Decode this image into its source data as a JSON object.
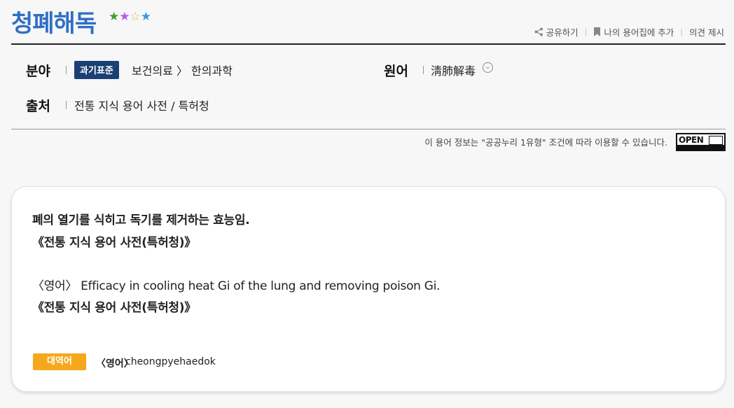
{
  "header": {
    "title": "청폐해독",
    "stars": [
      "★",
      "★",
      "☆",
      "★"
    ],
    "actions": {
      "share": "공유하기",
      "add_to_book": "나의 용어집에 추가",
      "feedback": "의견 제시"
    }
  },
  "fields": {
    "field_label": "분야",
    "field_badge": "과기표준",
    "field_value": "보건의료 〉 한의과학",
    "origin_label": "원어",
    "origin_value": "淸肺解毒",
    "source_label": "출처",
    "source_value": "전통 지식 용어 사전 / 특허청"
  },
  "license": {
    "text": "이 용어 정보는 \"공공누리 1유형\" 조건에 따라 이용할 수 있습니다.",
    "logo_word": "OPEN"
  },
  "definition": {
    "korean": "폐의 열기를 식히고 독기를 제거하는 효능임.",
    "korean_source": "《전통 지식 용어 사전(특허청)》",
    "english": "〈영어〉 Efficacy in cooling heat Gi of the lung and removing poison Gi.",
    "english_source": "《전통 지식 용어 사전(특허청)》",
    "equiv_tag": "대역어",
    "equiv_lang": "〈영어〉",
    "equiv_value": "cheongpyehaedok"
  },
  "colors": {
    "title": "#2f6fc7",
    "badge": "#1a3f73",
    "equiv_tag": "#f5a81c"
  }
}
